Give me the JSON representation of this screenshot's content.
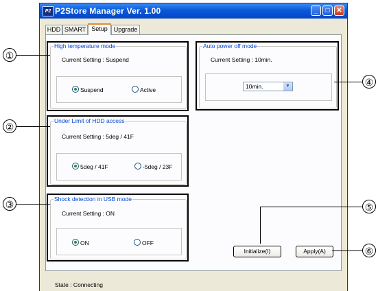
{
  "window": {
    "title": "P2Store Manager    Ver. 1.00",
    "icon_label": "P2"
  },
  "tabs": [
    "HDD",
    "SMART",
    "Setup",
    "Upgrade"
  ],
  "active_tab": "Setup",
  "groups": {
    "high_temp": {
      "legend": "High temperature mode",
      "current": "Current Setting :  Suspend",
      "options": [
        "Suspend",
        "Active"
      ],
      "selected": "Suspend"
    },
    "hdd_limit": {
      "legend": "Under Limit of HDD access",
      "current": "Current Setting :   5deg / 41F",
      "options": [
        "5deg / 41F",
        "-5deg / 23F"
      ],
      "selected": "5deg / 41F"
    },
    "shock": {
      "legend": "Shock detection in USB mode",
      "current": "Current Setting : ON",
      "options": [
        "ON",
        "OFF"
      ],
      "selected": "ON"
    },
    "auto_power": {
      "legend": "Auto power off mode",
      "current": "Current Setting :   10min.",
      "select_value": "10min."
    }
  },
  "buttons": {
    "initialize": "Initialize(I)",
    "apply": "Apply(A)"
  },
  "status": "State :  Connecting",
  "callouts": [
    "①",
    "②",
    "③",
    "④",
    "⑤",
    "⑥"
  ]
}
